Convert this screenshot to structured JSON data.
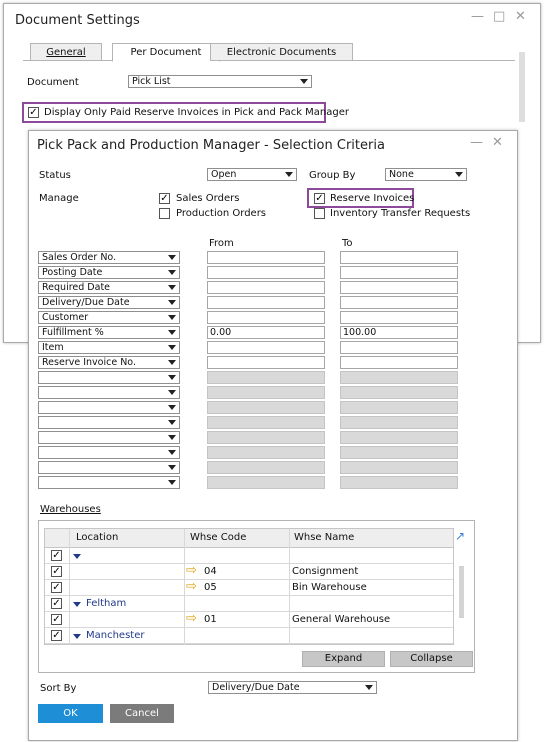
{
  "doc_settings": {
    "title": "Document Settings",
    "tabs": [
      "General",
      "Per Document",
      "Electronic Documents"
    ],
    "document_label": "Document",
    "document_value": "Pick List",
    "checkbox_label": "Display Only Paid Reserve Invoices in Pick and Pack Manager",
    "checkbox_checked": true
  },
  "criteria": {
    "title": "Pick Pack and Production Manager - Selection Criteria",
    "status_label": "Status",
    "status_value": "Open",
    "group_by_label": "Group By",
    "group_by_value": "None",
    "manage_label": "Manage",
    "sales_orders": "Sales Orders",
    "production_orders": "Production Orders",
    "reserve_invoices": "Reserve Invoices",
    "inventory_transfer": "Inventory Transfer Requests",
    "from_label": "From",
    "to_label": "To",
    "rows": [
      {
        "name": "Sales Order No.",
        "from": "",
        "to": ""
      },
      {
        "name": "Posting Date",
        "from": "",
        "to": ""
      },
      {
        "name": "Required Date",
        "from": "",
        "to": ""
      },
      {
        "name": "Delivery/Due Date",
        "from": "",
        "to": ""
      },
      {
        "name": "Customer",
        "from": "",
        "to": ""
      },
      {
        "name": "Fulfillment %",
        "from": "0.00",
        "to": "100.00"
      },
      {
        "name": "Item",
        "from": "",
        "to": ""
      },
      {
        "name": "Reserve Invoice No.",
        "from": "",
        "to": ""
      }
    ],
    "warehouses_label": "Warehouses",
    "grid_headers": [
      "Location",
      "Whse Code",
      "Whse Name"
    ],
    "grid_rows": [
      {
        "location": "",
        "code": "",
        "name": ""
      },
      {
        "location": "",
        "code": "04",
        "name": "Consignment"
      },
      {
        "location": "",
        "code": "05",
        "name": "Bin Warehouse"
      },
      {
        "location": "Feltham",
        "code": "",
        "name": ""
      },
      {
        "location": "",
        "code": "01",
        "name": "General Warehouse"
      },
      {
        "location": "Manchester",
        "code": "",
        "name": ""
      }
    ],
    "expand_label": "Expand",
    "collapse_label": "Collapse",
    "sort_by_label": "Sort By",
    "sort_by_value": "Delivery/Due Date",
    "ok_label": "OK",
    "cancel_label": "Cancel"
  },
  "colors": {
    "highlight": "#8e4a9a",
    "ok_button": "#1e8fd6",
    "arrow_icon": "#e8a318",
    "link_blue": "#1f3a8a"
  }
}
